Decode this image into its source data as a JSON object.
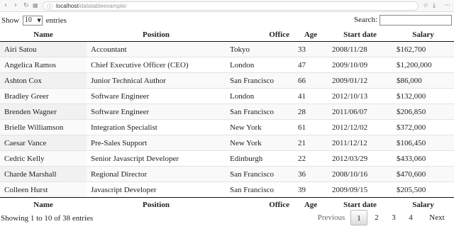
{
  "browser": {
    "url_host": "localhost",
    "url_path": "/datatableexample/"
  },
  "controls": {
    "show_label": "Show",
    "entries_value": "10",
    "entries_label": "entries",
    "search_label": "Search:",
    "search_value": ""
  },
  "table": {
    "headers": [
      "Name",
      "Position",
      "Office",
      "Age",
      "Start date",
      "Salary"
    ],
    "rows": [
      [
        "Airi Satou",
        "Accountant",
        "Tokyo",
        "33",
        "2008/11/28",
        "$162,700"
      ],
      [
        "Angelica Ramos",
        "Chief Executive Officer (CEO)",
        "London",
        "47",
        "2009/10/09",
        "$1,200,000"
      ],
      [
        "Ashton Cox",
        "Junior Technical Author",
        "San Francisco",
        "66",
        "2009/01/12",
        "$86,000"
      ],
      [
        "Bradley Greer",
        "Software Engineer",
        "London",
        "41",
        "2012/10/13",
        "$132,000"
      ],
      [
        "Brenden Wagner",
        "Software Engineer",
        "San Francisco",
        "28",
        "2011/06/07",
        "$206,850"
      ],
      [
        "Brielle Williamson",
        "Integration Specialist",
        "New York",
        "61",
        "2012/12/02",
        "$372,000"
      ],
      [
        "Caesar Vance",
        "Pre-Sales Support",
        "New York",
        "21",
        "2011/12/12",
        "$106,450"
      ],
      [
        "Cedric Kelly",
        "Senior Javascript Developer",
        "Edinburgh",
        "22",
        "2012/03/29",
        "$433,060"
      ],
      [
        "Charde Marshall",
        "Regional Director",
        "San Francisco",
        "36",
        "2008/10/16",
        "$470,600"
      ],
      [
        "Colleen Hurst",
        "Javascript Developer",
        "San Francisco",
        "39",
        "2009/09/15",
        "$205,500"
      ]
    ]
  },
  "footer": {
    "info": "Showing 1 to 10 of 38 entries",
    "previous": "Previous",
    "pages": [
      "1",
      "2",
      "3",
      "4"
    ],
    "current_page": "1",
    "next": "Next"
  }
}
